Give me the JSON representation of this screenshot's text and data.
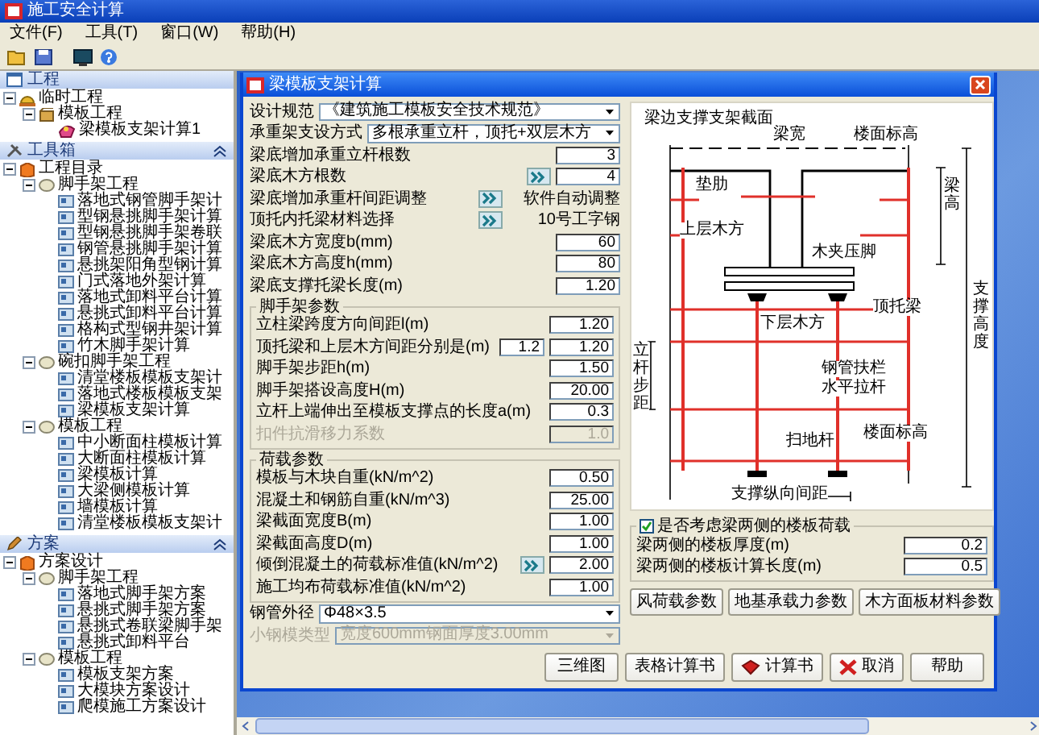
{
  "window": {
    "title": "施工安全计算"
  },
  "menu": [
    "文件(F)",
    "工具(T)",
    "窗口(W)",
    "帮助(H)"
  ],
  "panels": [
    {
      "title": "工程",
      "collapsible": false,
      "tree": [
        {
          "label": "临时工程",
          "kind": "project",
          "expanded": true,
          "children": [
            {
              "label": "模板工程",
              "kind": "box",
              "expanded": true,
              "children": [
                {
                  "label": "梁模板支架计算1",
                  "kind": "calc"
                }
              ]
            }
          ]
        }
      ]
    },
    {
      "title": "工具箱",
      "collapsible": true,
      "tree": [
        {
          "label": "工程目录",
          "kind": "catalog",
          "expanded": true,
          "children": [
            {
              "label": "脚手架工程",
              "kind": "category",
              "expanded": true,
              "children": [
                {
                  "label": "落地式钢管脚手架计",
                  "kind": "doc"
                },
                {
                  "label": "型钢悬挑脚手架计算",
                  "kind": "doc"
                },
                {
                  "label": "型钢悬挑脚手架卷联",
                  "kind": "doc"
                },
                {
                  "label": "钢管悬挑脚手架计算",
                  "kind": "doc"
                },
                {
                  "label": "悬挑架阳角型钢计算",
                  "kind": "doc"
                },
                {
                  "label": "门式落地外架计算",
                  "kind": "doc"
                },
                {
                  "label": "落地式卸料平台计算",
                  "kind": "doc"
                },
                {
                  "label": "悬挑式卸料平台计算",
                  "kind": "doc"
                },
                {
                  "label": "格构式型钢井架计算",
                  "kind": "doc"
                },
                {
                  "label": "竹木脚手架计算",
                  "kind": "doc"
                }
              ]
            },
            {
              "label": "碗扣脚手架工程",
              "kind": "category",
              "expanded": true,
              "children": [
                {
                  "label": "清堂楼板模板支架计",
                  "kind": "doc"
                },
                {
                  "label": "落地式楼板模板支架",
                  "kind": "doc"
                },
                {
                  "label": "梁模板支架计算",
                  "kind": "doc"
                }
              ]
            },
            {
              "label": "模板工程",
              "kind": "category",
              "expanded": true,
              "children": [
                {
                  "label": "中小断面柱模板计算",
                  "kind": "doc"
                },
                {
                  "label": "大断面柱模板计算",
                  "kind": "doc"
                },
                {
                  "label": "梁模板计算",
                  "kind": "doc"
                },
                {
                  "label": "大梁侧模板计算",
                  "kind": "doc"
                },
                {
                  "label": "墙模板计算",
                  "kind": "doc"
                },
                {
                  "label": "清堂楼板模板支架计",
                  "kind": "doc"
                }
              ]
            }
          ]
        }
      ]
    },
    {
      "title": "方案",
      "collapsible": true,
      "tree": [
        {
          "label": "方案设计",
          "kind": "catalog",
          "expanded": true,
          "children": [
            {
              "label": "脚手架工程",
              "kind": "category",
              "expanded": true,
              "children": [
                {
                  "label": "落地式脚手架方案",
                  "kind": "doc"
                },
                {
                  "label": "悬挑式脚手架方案",
                  "kind": "doc"
                },
                {
                  "label": "悬挑式卷联梁脚手架",
                  "kind": "doc"
                },
                {
                  "label": "悬挑式卸料平台",
                  "kind": "doc"
                }
              ]
            },
            {
              "label": "模板工程",
              "kind": "category",
              "expanded": true,
              "children": [
                {
                  "label": "模板支架方案",
                  "kind": "doc"
                },
                {
                  "label": "大模块方案设计",
                  "kind": "doc"
                },
                {
                  "label": "爬模施工方案设计",
                  "kind": "doc"
                }
              ]
            }
          ]
        }
      ]
    }
  ],
  "dialog": {
    "title": "梁模板支架计算",
    "top_rows": [
      {
        "label": "设计规范",
        "kind": "select",
        "value": "《建筑施工模板安全技术规范》",
        "button": false,
        "disabled": false
      },
      {
        "label": "承重架支设方式",
        "kind": "select",
        "value": "多根承重立杆，顶托+双层木方",
        "button": false,
        "disabled": false
      },
      {
        "label": "梁底增加承重立杆根数",
        "kind": "input",
        "value": "3",
        "button": false,
        "disabled": false
      },
      {
        "label": "梁底木方根数",
        "kind": "input",
        "value": "4",
        "button": true,
        "disabled": false
      },
      {
        "label": "梁底增加承重杆间距调整",
        "kind": "note",
        "value": "软件自动调整",
        "button": true,
        "disabled": false
      },
      {
        "label": "顶托内托梁材料选择",
        "kind": "note",
        "value": "10号工字钢",
        "button": true,
        "disabled": false
      },
      {
        "label": "梁底木方宽度b(mm)",
        "kind": "input",
        "value": "60",
        "button": false,
        "disabled": false
      },
      {
        "label": "梁底木方高度h(mm)",
        "kind": "input",
        "value": "80",
        "button": false,
        "disabled": false
      },
      {
        "label": "梁底支撑托梁长度(m)",
        "kind": "input",
        "value": "1.20",
        "button": false,
        "disabled": false
      }
    ],
    "scaffold_group": {
      "title": "脚手架参数",
      "rows": [
        {
          "label": "立柱梁跨度方向间距l(m)",
          "kind": "input",
          "value": "1.20",
          "button": false,
          "disabled": false
        },
        {
          "label": "顶托梁和上层木方间距分别是(m)",
          "kind": "pair",
          "value": "1.2",
          "value_2": "1.20",
          "button": false,
          "disabled": false
        },
        {
          "label": "脚手架步距h(m)",
          "kind": "input",
          "value": "1.50",
          "button": false,
          "disabled": false
        },
        {
          "label": "脚手架搭设高度H(m)",
          "kind": "input",
          "value": "20.00",
          "button": false,
          "disabled": false
        },
        {
          "label": "立杆上端伸出至模板支撑点的长度a(m)",
          "kind": "input",
          "value": "0.3",
          "button": false,
          "disabled": false
        },
        {
          "label": "扣件抗滑移力系数",
          "kind": "input",
          "value": "1.0",
          "button": false,
          "disabled": true
        }
      ]
    },
    "load_group": {
      "title": "荷载参数",
      "rows": [
        {
          "label": "模板与木块自重(kN/m^2)",
          "kind": "input",
          "value": "0.50",
          "button": false,
          "disabled": false
        },
        {
          "label": "混凝土和钢筋自重(kN/m^3)",
          "kind": "input",
          "value": "25.00",
          "button": false,
          "disabled": false
        },
        {
          "label": "梁截面宽度B(m)",
          "kind": "input",
          "value": "1.00",
          "button": false,
          "disabled": false
        },
        {
          "label": "梁截面高度D(m)",
          "kind": "input",
          "value": "1.00",
          "button": false,
          "disabled": false
        },
        {
          "label": "倾倒混凝土的荷载标准值(kN/m^2)",
          "kind": "input",
          "value": "2.00",
          "button": true,
          "disabled": false
        },
        {
          "label": "施工均布荷载标准值(kN/m^2)",
          "kind": "input",
          "value": "1.00",
          "button": false,
          "disabled": false
        }
      ]
    },
    "bottom_rows": [
      {
        "label": "钢管外径",
        "kind": "select",
        "value": "Φ48×3.5",
        "button": false,
        "disabled": false
      },
      {
        "label": "小钢模类型",
        "kind": "select",
        "value": "宽度600mm钢面厚度3.00mm",
        "button": false,
        "disabled": true
      }
    ],
    "drawing_labels": [
      {
        "text": "梁边支撑支架截面",
        "kind": "horizontal"
      },
      {
        "text": "梁宽",
        "kind": "horizontal"
      },
      {
        "text": "楼面标高",
        "kind": "horizontal"
      },
      {
        "text": "垫肋",
        "kind": "horizontal"
      },
      {
        "text": "上层木方",
        "kind": "horizontal"
      },
      {
        "text": "木夹压脚",
        "kind": "horizontal"
      },
      {
        "text": "下层木方",
        "kind": "horizontal"
      },
      {
        "text": "顶托梁",
        "kind": "horizontal"
      },
      {
        "text": "钢管扶栏",
        "kind": "horizontal"
      },
      {
        "text": "水平拉杆",
        "kind": "horizontal"
      },
      {
        "text": "扫地杆",
        "kind": "horizontal"
      },
      {
        "text": "楼面标高",
        "kind": "horizontal"
      },
      {
        "text": "支撑纵向间距",
        "kind": "horizontal"
      },
      {
        "text": "立杆步距",
        "kind": "vertical"
      },
      {
        "text": "梁高",
        "kind": "vertical"
      },
      {
        "text": "支撑高度",
        "kind": "vertical"
      }
    ],
    "slab_group": {
      "label": "是否考虑梁两侧的楼板荷载",
      "checked": true,
      "rows": [
        {
          "label": "梁两侧的楼板厚度(m)",
          "value": "0.2"
        },
        {
          "label": "梁两侧的楼板计算长度(m)",
          "value": "0.5"
        }
      ]
    },
    "param_buttons": [
      "风荷载参数",
      "地基承载力参数",
      "木方面板材料参数"
    ],
    "buttons": [
      {
        "label": "三维图",
        "kind": "plain"
      },
      {
        "label": "表格计算书",
        "kind": "plain"
      },
      {
        "label": "计算书",
        "kind": "report"
      },
      {
        "label": "取消",
        "kind": "cancel"
      },
      {
        "label": "帮助",
        "kind": "plain"
      }
    ]
  }
}
